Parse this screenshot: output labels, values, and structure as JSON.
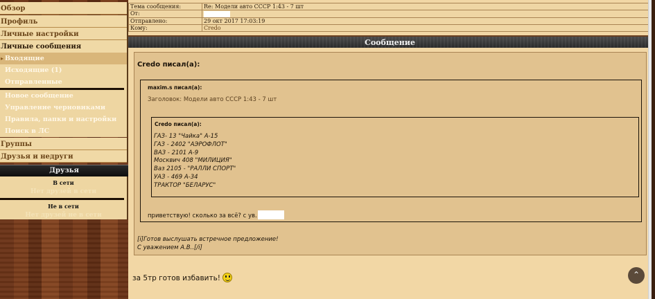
{
  "sidebar": {
    "overview": "Обзор",
    "profile": "Профиль",
    "settings": "Личные настройки",
    "messages_title": "Личные сообщения",
    "messages_items": [
      {
        "label": "Входящие"
      },
      {
        "label": "Исходящие (1)"
      },
      {
        "label": "Отправленные"
      }
    ],
    "actions": [
      {
        "label": "Новое сообщение"
      },
      {
        "label": "Управление черновиками"
      },
      {
        "label": "Правила, папки и настройки"
      },
      {
        "label": "Поиск в ЛС"
      }
    ],
    "groups": "Группы",
    "friends_foes": "Друзья и недруги",
    "friends_title": "Друзья",
    "online_label": "В сети",
    "online_empty": "Нет друзей в сети",
    "offline_label": "Не в сети",
    "offline_empty": "Нет друзей не в сети"
  },
  "meta": {
    "subject_label": "Тема сообщения:",
    "subject_value": "Re: Модели авто СССР 1:43 - 7 шт",
    "from_label": "От:",
    "sent_label": "Отправлено:",
    "sent_value": "29 окт 2017 17:03:19",
    "to_label": "Кому:",
    "to_value": "Credo"
  },
  "message": {
    "bar_title": "Сообщение",
    "author_line": "Credo писал(а):",
    "quote1_author": "maxim.s писал(а):",
    "quote1_subject": "Заголовок: Модели авто СССР 1:43 - 7 шт",
    "quote2_author": "Credo писал(а):",
    "quote2_lines": [
      "ГАЗ- 13 \"Чайка\" А-15",
      "ГАЗ - 2402 \"АЭРОФЛОТ\"",
      "ВАЗ - 2101 А-9",
      "Москвич 408 \"МИЛИЦИЯ\"",
      "Ваз 2105 - \"РАЛЛИ СПОРТ\"",
      "УАЗ - 469 А-34",
      "ТРАКТОР \"БЕЛАРУС\""
    ],
    "quote1_footer": "приветствую! сколько за всё? с ув.",
    "signature_line1": "[i]Готов выслушать встречное предложение!",
    "signature_line2": "С уважением А.В..[/i]",
    "body": "за 5тр готов избавить!"
  }
}
